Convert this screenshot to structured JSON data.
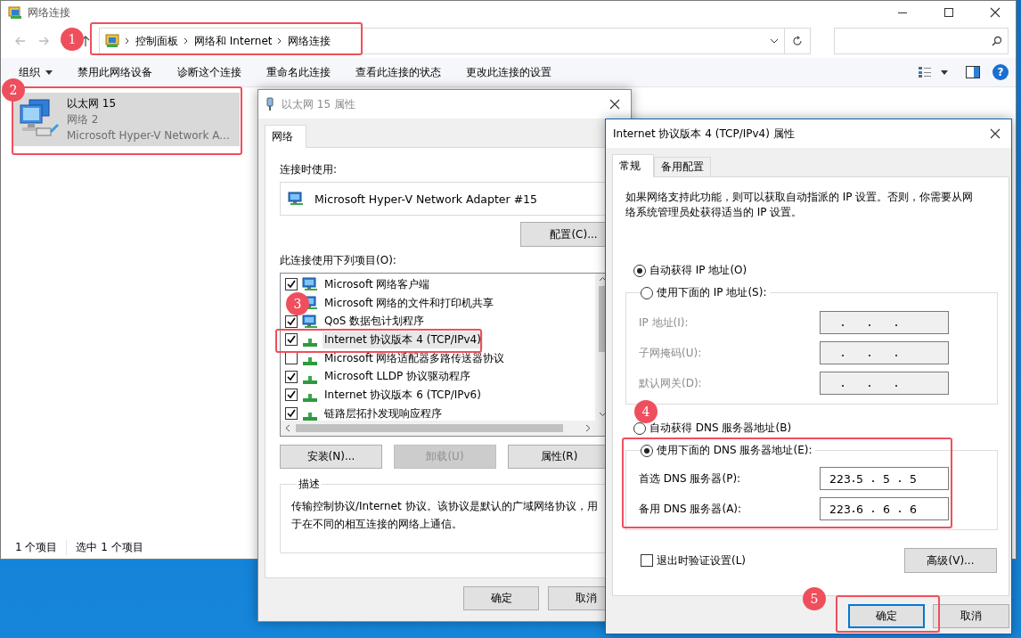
{
  "explorer": {
    "title": "网络连接",
    "breadcrumb": [
      "控制面板",
      "网络和 Internet",
      "网络连接"
    ],
    "toolbar": [
      {
        "label": "组织",
        "kind": "menu"
      },
      {
        "label": "禁用此网络设备",
        "kind": "command"
      },
      {
        "label": "诊断这个连接",
        "kind": "command"
      },
      {
        "label": "重命名此连接",
        "kind": "command"
      },
      {
        "label": "查看此连接的状态",
        "kind": "command"
      },
      {
        "label": "更改此连接的设置",
        "kind": "command"
      }
    ],
    "help": "?",
    "connections": [
      {
        "name": "以太网 15",
        "network": "网络 2",
        "device": "Microsoft Hyper-V Network A...",
        "selected": true
      }
    ],
    "status": [
      "1 个项目",
      "选中 1 个项目"
    ]
  },
  "properties": {
    "title": "以太网 15 属性",
    "tabs": [
      {
        "label": "网络",
        "selected": true
      }
    ],
    "connect_label": "连接时使用:",
    "adapter": "Microsoft Hyper-V Network Adapter #15",
    "configure": "配置(C)...",
    "items_label": "此连接使用下列项目(O):",
    "components": [
      {
        "label": "Microsoft 网络客户端",
        "kind": "client",
        "checked": true,
        "selected": false
      },
      {
        "label": "Microsoft 网络的文件和打印机共享",
        "kind": "client",
        "selected": false
      },
      {
        "label": "QoS 数据包计划程序",
        "kind": "client",
        "checked": true,
        "selected": false
      },
      {
        "label": "Internet 协议版本 4 (TCP/IPv4)",
        "kind": "protocol",
        "checked": true,
        "selected": true
      },
      {
        "label": "Microsoft 网络适配器多路传送器协议",
        "kind": "protocol",
        "checked": false,
        "selected": false
      },
      {
        "label": "Microsoft LLDP 协议驱动程序",
        "kind": "protocol",
        "checked": true,
        "selected": false
      },
      {
        "label": "Internet 协议版本 6 (TCP/IPv6)",
        "kind": "protocol",
        "checked": true,
        "selected": false
      },
      {
        "label": "链路层拓扑发现响应程序",
        "kind": "protocol",
        "checked": true,
        "selected": false
      }
    ],
    "actions": [
      {
        "label": "安装(N)...",
        "disabled": false
      },
      {
        "label": "卸载(U)",
        "disabled": true
      },
      {
        "label": "属性(R)",
        "disabled": false
      }
    ],
    "description_title": "描述",
    "description": "传输控制协议/Internet 协议。该协议是默认的广域网络协议，用于在不同的相互连接的网络上通信。",
    "buttons": [
      {
        "label": "确定"
      },
      {
        "label": "取消"
      }
    ]
  },
  "ipv4": {
    "title": "Internet 协议版本 4 (TCP/IPv4) 属性",
    "tabs": [
      {
        "label": "常规",
        "selected": true
      },
      {
        "label": "备用配置",
        "selected": false
      }
    ],
    "intro": "如果网络支持此功能，则可以获取自动指派的 IP 设置。否则，你需要从网络系统管理员处获得适当的 IP 设置。",
    "ip_modes": [
      {
        "label": "自动获得 IP 地址(O)",
        "selected": true
      },
      {
        "label": "使用下面的 IP 地址(S):",
        "selected": false
      }
    ],
    "ip_fields": [
      {
        "label": "IP 地址(I):",
        "disabled": true
      },
      {
        "label": "子网掩码(U):",
        "disabled": true
      },
      {
        "label": "默认网关(D):",
        "disabled": true
      }
    ],
    "dns_modes": [
      {
        "label": "自动获得 DNS 服务器地址(B)",
        "selected": false
      },
      {
        "label": "使用下面的 DNS 服务器地址(E):",
        "selected": true
      }
    ],
    "dns_fields": [
      {
        "label": "首选 DNS 服务器(P):",
        "octets": [
          "223",
          "5",
          "5",
          "5"
        ],
        "disabled": false
      },
      {
        "label": "备用 DNS 服务器(A):",
        "octets": [
          "223",
          "6",
          "6",
          "6"
        ],
        "disabled": false
      }
    ],
    "validate": {
      "label": "退出时验证设置(L)",
      "checked": false
    },
    "advanced": "高级(V)...",
    "buttons": [
      {
        "label": "确定",
        "default": true
      },
      {
        "label": "取消",
        "default": false
      }
    ]
  },
  "callouts": [
    "1",
    "2",
    "3",
    "4",
    "5"
  ]
}
